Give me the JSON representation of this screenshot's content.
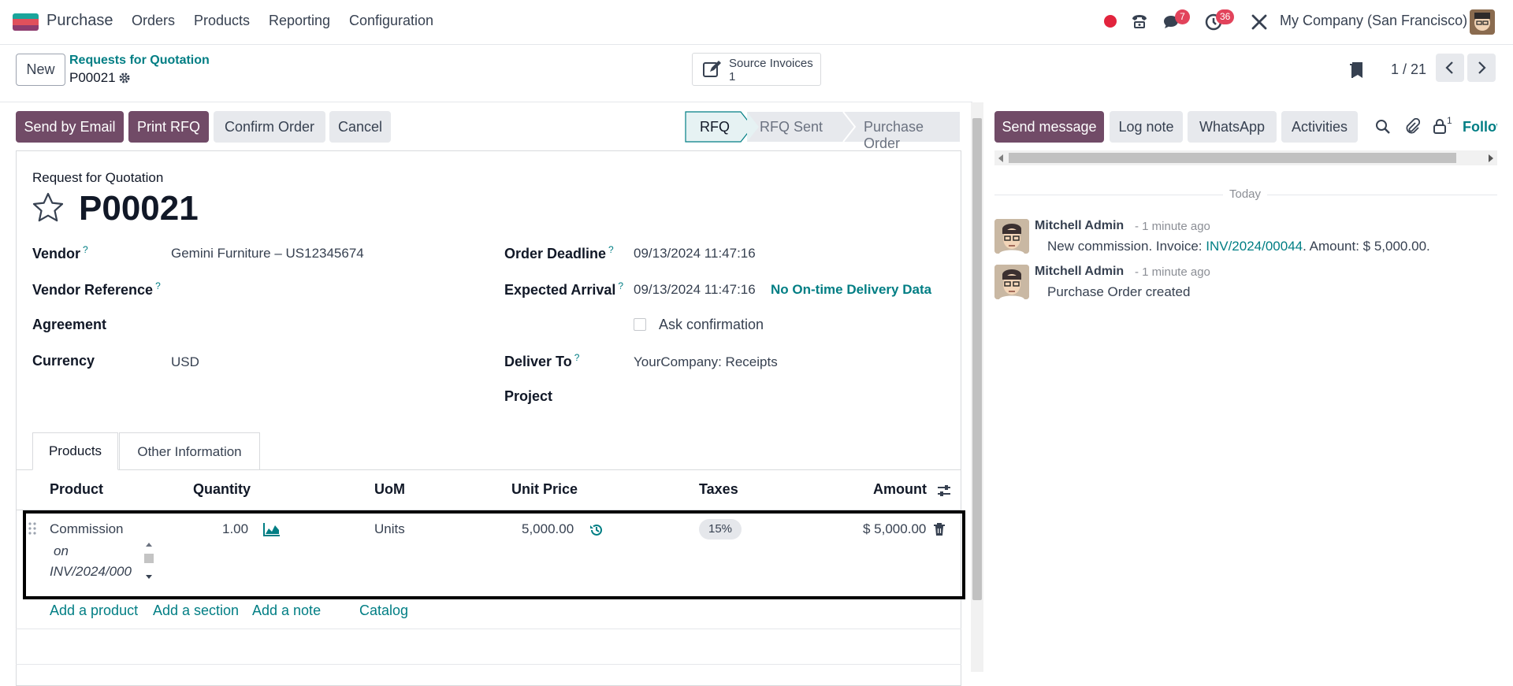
{
  "nav": {
    "app_name": "Purchase",
    "menu": [
      "Orders",
      "Products",
      "Reporting",
      "Configuration"
    ],
    "messages_count": "7",
    "activities_count": "36",
    "company": "My Company (San Francisco)"
  },
  "control": {
    "new_label": "New",
    "breadcrumb_parent": "Requests for Quotation",
    "record_name": "P00021",
    "smart_button_label": "Source Invoices",
    "smart_button_count": "1",
    "pager": "1 / 21"
  },
  "actions": {
    "send_email": "Send by Email",
    "print_rfq": "Print RFQ",
    "confirm": "Confirm Order",
    "cancel": "Cancel"
  },
  "statusbar": [
    "RFQ",
    "RFQ Sent",
    "Purchase Order"
  ],
  "form": {
    "title_small": "Request for Quotation",
    "title": "P00021",
    "vendor_label": "Vendor",
    "vendor": "Gemini Furniture – US12345674",
    "vendor_ref_label": "Vendor Reference",
    "agreement_label": "Agreement",
    "currency_label": "Currency",
    "currency": "USD",
    "deadline_label": "Order Deadline",
    "deadline": "09/13/2024 11:47:16",
    "arrival_label": "Expected Arrival",
    "arrival": "09/13/2024 11:47:16",
    "ontime": "No On-time Delivery Data",
    "ask_confirmation": "Ask confirmation",
    "deliver_label": "Deliver To",
    "deliver": "YourCompany: Receipts",
    "project_label": "Project",
    "help_mark": "?"
  },
  "tabs": [
    "Products",
    "Other Information"
  ],
  "lines": {
    "headers": [
      "Product",
      "Quantity",
      "UoM",
      "Unit Price",
      "Taxes",
      "Amount"
    ],
    "row": {
      "product": "Commission",
      "desc_1": "on",
      "desc_2": "INV/2024/000",
      "qty": "1.00",
      "uom": "Units",
      "price": "5,000.00",
      "tax": "15%",
      "amount": "$ 5,000.00"
    },
    "add_product": "Add a product",
    "add_section": "Add a section",
    "add_note": "Add a note",
    "catalog": "Catalog"
  },
  "chatter": {
    "send_message": "Send message",
    "log_note": "Log note",
    "whatsapp": "WhatsApp",
    "activities": "Activities",
    "followers_count": "1",
    "follow": "Follow",
    "date_sep": "Today",
    "messages": [
      {
        "author": "Mitchell Admin",
        "time": "- 1 minute ago",
        "text_pre": "New commission. Invoice: ",
        "link": "INV/2024/00044",
        "text_post": ". Amount: $ 5,000.00."
      },
      {
        "author": "Mitchell Admin",
        "time": "- 1 minute ago",
        "text_pre": "Purchase Order created",
        "link": "",
        "text_post": ""
      }
    ]
  },
  "colors": {
    "primary": "#714b67",
    "link": "#017e84",
    "badge": "#e2435b"
  }
}
